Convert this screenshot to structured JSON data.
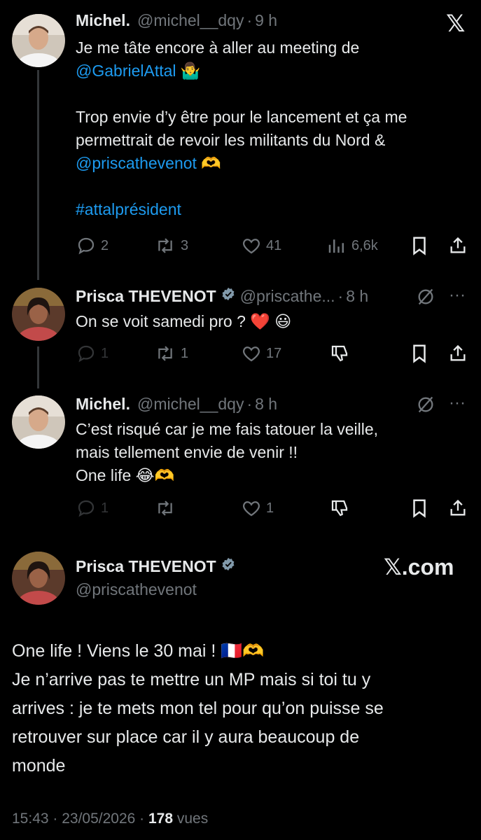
{
  "top_right_logo": "𝕏",
  "tweets": [
    {
      "name": "Michel.",
      "handle": "@michel__dqy",
      "time": "9 h",
      "lines": [
        [
          "Je me tâte encore à aller au meeting de"
        ],
        [
          "@GabrielAttal",
          " 🤷‍♂️"
        ],
        [
          ""
        ],
        [
          "Trop envie d’y être pour le lancement et ça me"
        ],
        [
          "permettrait de revoir les militants du Nord &"
        ],
        [
          "@priscathevenot",
          " 🫶"
        ],
        [
          ""
        ],
        [
          "#attalprésident"
        ]
      ],
      "actions": {
        "replies": "2",
        "reposts": "3",
        "likes": "41",
        "views": "6,6k"
      }
    },
    {
      "name": "Prisca THEVENOT",
      "handle": "@priscathe...",
      "time": "8 h",
      "text": "On se voit samedi pro ? ❤️ 😃",
      "actions": {
        "replies": "1",
        "reposts": "1",
        "likes": "17"
      }
    },
    {
      "name": "Michel.",
      "handle": "@michel__dqy",
      "time": "8 h",
      "lines_plain": [
        "C’est risqué car je me fais tatouer la veille,",
        "mais tellement envie de venir !!",
        "One life 😂🫶"
      ],
      "actions": {
        "replies": "1",
        "reposts": "",
        "likes": "1"
      }
    }
  ],
  "main_tweet": {
    "name": "Prisca THEVENOT",
    "handle": "@priscathevenot",
    "brand": "𝕏.com",
    "lines": [
      "One life ! Viens le 30 mai ! 🇫🇷🫶",
      "Je n’arrive pas te mettre un MP mais si toi tu y",
      "arrives : je te mets mon tel pour qu’on puisse se",
      "retrouver sur place car il y aura beaucoup de",
      "monde"
    ],
    "timestamp": "15:43 · 23/05/2026 · ",
    "views_count": "178",
    "views_label": " vues"
  },
  "colors": {
    "accent": "#1d9bf0",
    "muted": "#71767b",
    "text": "#e7e9ea",
    "bg": "#000000"
  }
}
